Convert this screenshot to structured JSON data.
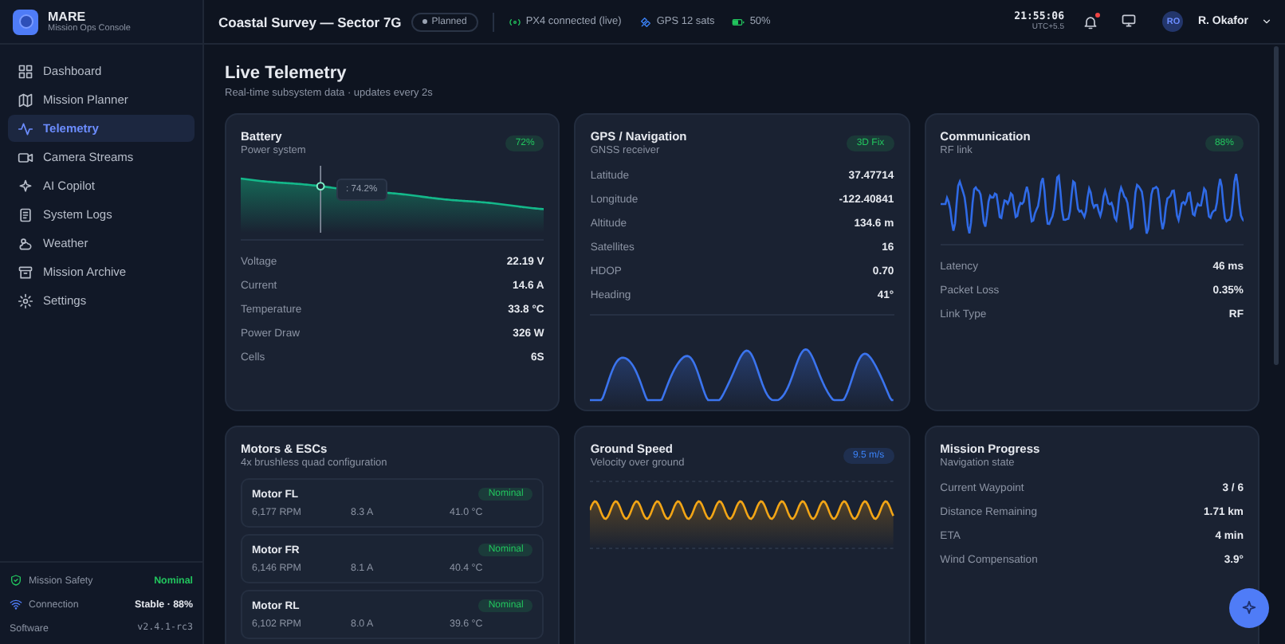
{
  "brand": {
    "name": "MARE",
    "subtitle": "Mission Ops Console"
  },
  "sidebar": {
    "items": [
      {
        "label": "Dashboard",
        "selected": false
      },
      {
        "label": "Mission Planner",
        "selected": false
      },
      {
        "label": "Telemetry",
        "selected": true
      },
      {
        "label": "Camera Streams",
        "selected": false
      },
      {
        "label": "AI Copilot",
        "selected": false
      },
      {
        "label": "System Logs",
        "selected": false
      },
      {
        "label": "Weather",
        "selected": false
      },
      {
        "label": "Mission Archive",
        "selected": false
      },
      {
        "label": "Settings",
        "selected": false
      }
    ],
    "footer": [
      {
        "kind": "status",
        "label": "Mission Safety",
        "value": "Nominal"
      },
      {
        "kind": "signal",
        "label": "Connection",
        "value": "Stable · 88%"
      },
      {
        "kind": "version",
        "label": "Software",
        "value": "v2.4.1-rc3"
      }
    ]
  },
  "topbar": {
    "mission": "Coastal Survey — Sector 7G",
    "chip": "Planned",
    "status": [
      {
        "text": "PX4 connected (live)"
      },
      {
        "text": "GPS 12 sats"
      },
      {
        "text": "50%"
      }
    ],
    "time": "21:55:06",
    "timezone": "UTC+5.5",
    "notification": true,
    "avatar": "RO",
    "user": "R. Okafor"
  },
  "page": {
    "title": "Live Telemetry",
    "subtitle": "Real-time subsystem data · updates every 2s"
  },
  "cards": [
    {
      "kind": "battery",
      "title": "Battery",
      "subtitle": "Power system",
      "badge": {
        "text": "72%",
        "color": "#22c55e"
      },
      "tooltip": ": 74.2%",
      "rows": [
        {
          "label": "Voltage",
          "value": "22.19 V"
        },
        {
          "label": "Current",
          "value": "14.6 A"
        },
        {
          "label": "Temperature",
          "value": "33.8 °C"
        },
        {
          "label": "Power Draw",
          "value": "326 W"
        },
        {
          "label": "Cells",
          "value": "6S"
        }
      ]
    },
    {
      "kind": "gps",
      "title": "GPS / Navigation",
      "subtitle": "GNSS receiver",
      "badge": {
        "text": "3D Fix",
        "color": "#22c55e"
      },
      "rows": [
        {
          "label": "Latitude",
          "value": "37.47714"
        },
        {
          "label": "Longitude",
          "value": "-122.40841"
        },
        {
          "label": "Altitude",
          "value": "134.6 m"
        },
        {
          "label": "Satellites",
          "value": "16"
        },
        {
          "label": "HDOP",
          "value": "0.70"
        },
        {
          "label": "Heading",
          "value": "41°"
        }
      ]
    },
    {
      "kind": "comm",
      "title": "Communication",
      "subtitle": "RF link",
      "badge": {
        "text": "88%",
        "color": "#22c55e"
      },
      "rows": [
        {
          "label": "Latency",
          "value": "46 ms"
        },
        {
          "label": "Packet Loss",
          "value": "0.35%"
        },
        {
          "label": "Link Type",
          "value": "RF"
        }
      ]
    },
    {
      "kind": "motors",
      "title": "Motors & ESCs",
      "subtitle": "4x brushless quad configuration",
      "motors": [
        {
          "name": "Motor FL",
          "rpm": "6,177 RPM",
          "current": "8.3 A",
          "temp": "41.0 °C",
          "status": {
            "text": "Nominal",
            "color": "#22c55e"
          }
        },
        {
          "name": "Motor FR",
          "rpm": "6,146 RPM",
          "current": "8.1 A",
          "temp": "40.4 °C",
          "status": {
            "text": "Nominal",
            "color": "#22c55e"
          }
        },
        {
          "name": "Motor RL",
          "rpm": "6,102 RPM",
          "current": "8.0 A",
          "temp": "39.6 °C",
          "status": {
            "text": "Nominal",
            "color": "#22c55e"
          }
        }
      ]
    },
    {
      "kind": "speed",
      "title": "Ground Speed",
      "subtitle": "Velocity over ground",
      "badge": {
        "text": "9.5 m/s",
        "color": "#3b82f6"
      }
    },
    {
      "kind": "progress",
      "title": "Mission Progress",
      "subtitle": "Navigation state",
      "rows": [
        {
          "label": "Current Waypoint",
          "value": "3 / 6"
        },
        {
          "label": "Distance Remaining",
          "value": "1.71 km"
        },
        {
          "label": "ETA",
          "value": "4 min"
        },
        {
          "label": "Wind Compensation",
          "value": "3.9°"
        }
      ]
    }
  ]
}
